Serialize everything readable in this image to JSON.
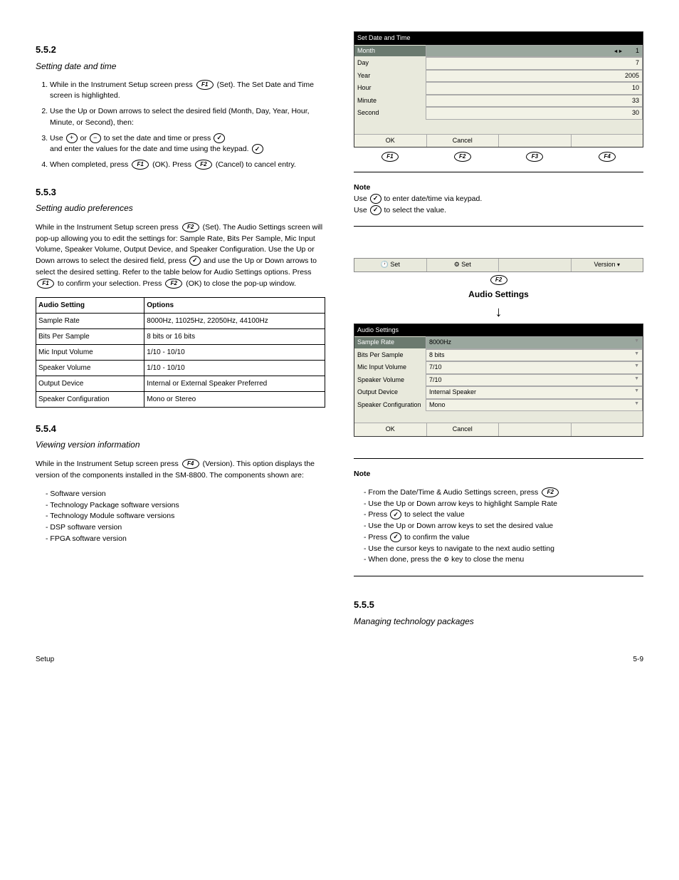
{
  "left": {
    "sec1_num": "5.5.2",
    "sec1_title": "Setting date and time",
    "sec1_steps": [
      "While in the Instrument Setup screen press ",
      " (Set). The Set Date and Time screen is highlighted.",
      "Use the Up or Down arrows to select the desired field (Month, Day, Year, Hour, Minute, or Second), then:",
      "Use ",
      " or ",
      " to set the date and time or press ",
      " and enter the values for the date and time using the keypad.",
      "When completed, press ",
      " (OK). Press ",
      " (Cancel) to cancel entry."
    ],
    "sec2_num": "5.5.3",
    "sec2_title": "Setting audio preferences",
    "sec2_text": "While in the Instrument Setup screen press ",
    "sec2_text2": " (Set). The Audio Settings screen will pop-up allowing you to edit the settings for: Sample Rate, Bits Per Sample, Mic Input Volume, Speaker Volume, Output Device, and Speaker Configuration. Use the Up or Down arrows to select the desired field, press ",
    "sec2_text3": " and use the Up or Down arrows to select the desired setting. Refer to the table below for Audio Settings options. Press ",
    "sec2_text4": " to confirm your selection. Press ",
    "sec2_text5": " (OK) to close the pop-up window.",
    "table_header": [
      "Audio Setting",
      "Options"
    ],
    "table_rows": [
      [
        "Sample Rate",
        "8000Hz, 11025Hz, 22050Hz, 44100Hz"
      ],
      [
        "Bits Per Sample",
        "8 bits or 16 bits"
      ],
      [
        "Mic Input Volume",
        "1/10 - 10/10"
      ],
      [
        "Speaker Volume",
        "1/10 - 10/10"
      ],
      [
        "Output Device",
        "Internal or External Speaker Preferred"
      ],
      [
        "Speaker Configuration",
        "Mono or Stereo"
      ]
    ],
    "sec3_num": "5.5.4",
    "sec3_title": "Viewing version information",
    "sec3_text1": "While in the Instrument Setup screen press ",
    "sec3_text2": " (Version). This option displays the version of the components installed in the SM-8800. The components shown are:",
    "components": [
      "Software version",
      "Technology Package software versions",
      "Technology Module software versions",
      "DSP software version",
      "FPGA software version"
    ]
  },
  "right": {
    "dt_dialog": {
      "title": "Set Date and Time",
      "rows": [
        {
          "label": "Month",
          "value": "1",
          "selected": true
        },
        {
          "label": "Day",
          "value": "7"
        },
        {
          "label": "Year",
          "value": "2005"
        },
        {
          "label": "Hour",
          "value": "10"
        },
        {
          "label": "Minute",
          "value": "33"
        },
        {
          "label": "Second",
          "value": "30"
        }
      ],
      "ok": "OK",
      "cancel": "Cancel"
    },
    "note1_hdr": "Note",
    "note1_body1": "Use ",
    "note1_body2": " to enter date/time via keypad.",
    "note1_body3": "Use ",
    "note1_body4": " to select the value.",
    "tabbar": {
      "t1": "Set",
      "t2": "Set",
      "t4": "Version"
    },
    "audio_label": "Audio Settings",
    "audio_dialog": {
      "title": "Audio Settings",
      "rows": [
        {
          "label": "Sample Rate",
          "value": "8000Hz",
          "selected": true
        },
        {
          "label": "Bits Per Sample",
          "value": "8 bits"
        },
        {
          "label": "Mic Input Volume",
          "value": "7/10"
        },
        {
          "label": "Speaker Volume",
          "value": "7/10"
        },
        {
          "label": "Output Device",
          "value": "Internal Speaker"
        },
        {
          "label": "Speaker Configuration",
          "value": "Mono"
        }
      ],
      "ok": "OK",
      "cancel": "Cancel"
    },
    "note2_hdr": "Note",
    "note2_lines": [
      "From the Date/Time & Audio Settings screen, press ",
      "Use the Up or Down arrow keys to highlight Sample Rate",
      "Press ",
      " to select the value",
      "Use the Up or Down arrow keys to set the desired value",
      "Press ",
      " to confirm the value",
      "Use the cursor keys to navigate to the next audio setting",
      "When done, press the ",
      " key to close the menu"
    ],
    "sec4_num": "5.5.5",
    "sec4_title": "Managing technology packages"
  },
  "footer_left": "Setup",
  "footer_right": "5-9"
}
